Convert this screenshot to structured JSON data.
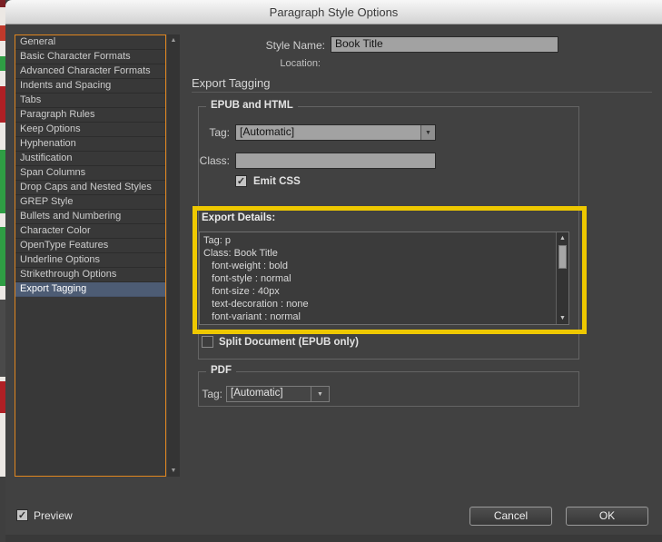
{
  "window": {
    "title": "Paragraph Style Options"
  },
  "sidebar": {
    "items": [
      {
        "label": "General",
        "selected": false
      },
      {
        "label": "Basic Character Formats",
        "selected": false
      },
      {
        "label": "Advanced Character Formats",
        "selected": false
      },
      {
        "label": "Indents and Spacing",
        "selected": false
      },
      {
        "label": "Tabs",
        "selected": false
      },
      {
        "label": "Paragraph Rules",
        "selected": false
      },
      {
        "label": "Keep Options",
        "selected": false
      },
      {
        "label": "Hyphenation",
        "selected": false
      },
      {
        "label": "Justification",
        "selected": false
      },
      {
        "label": "Span Columns",
        "selected": false
      },
      {
        "label": "Drop Caps and Nested Styles",
        "selected": false
      },
      {
        "label": "GREP Style",
        "selected": false
      },
      {
        "label": "Bullets and Numbering",
        "selected": false
      },
      {
        "label": "Character Color",
        "selected": false
      },
      {
        "label": "OpenType Features",
        "selected": false
      },
      {
        "label": "Underline Options",
        "selected": false
      },
      {
        "label": "Strikethrough Options",
        "selected": false
      },
      {
        "label": "Export Tagging",
        "selected": true
      }
    ]
  },
  "header": {
    "style_name_label": "Style Name:",
    "style_name_value": "Book Title",
    "location_label": "Location:",
    "section_title": "Export Tagging"
  },
  "epub_html": {
    "legend": "EPUB and HTML",
    "tag_label": "Tag:",
    "tag_value": "[Automatic]",
    "class_label": "Class:",
    "class_value": "",
    "emit_css_label": "Emit CSS",
    "emit_css_checked": true,
    "export_details_label": "Export Details:",
    "export_details_lines": [
      "Tag: p",
      "Class: Book Title",
      "   font-weight : bold",
      "   font-style : normal",
      "   font-size : 40px",
      "   text-decoration : none",
      "   font-variant : normal"
    ],
    "split_document_label": "Split Document (EPUB only)",
    "split_document_checked": false
  },
  "pdf": {
    "legend": "PDF",
    "tag_label": "Tag:",
    "tag_value": "[Automatic]"
  },
  "footer": {
    "preview_label": "Preview",
    "preview_checked": true,
    "cancel_label": "Cancel",
    "ok_label": "OK"
  },
  "colors": {
    "highlight_yellow": "#eec800",
    "focus_ring_orange": "#e0861f",
    "selection_blue": "#4d5c74"
  }
}
